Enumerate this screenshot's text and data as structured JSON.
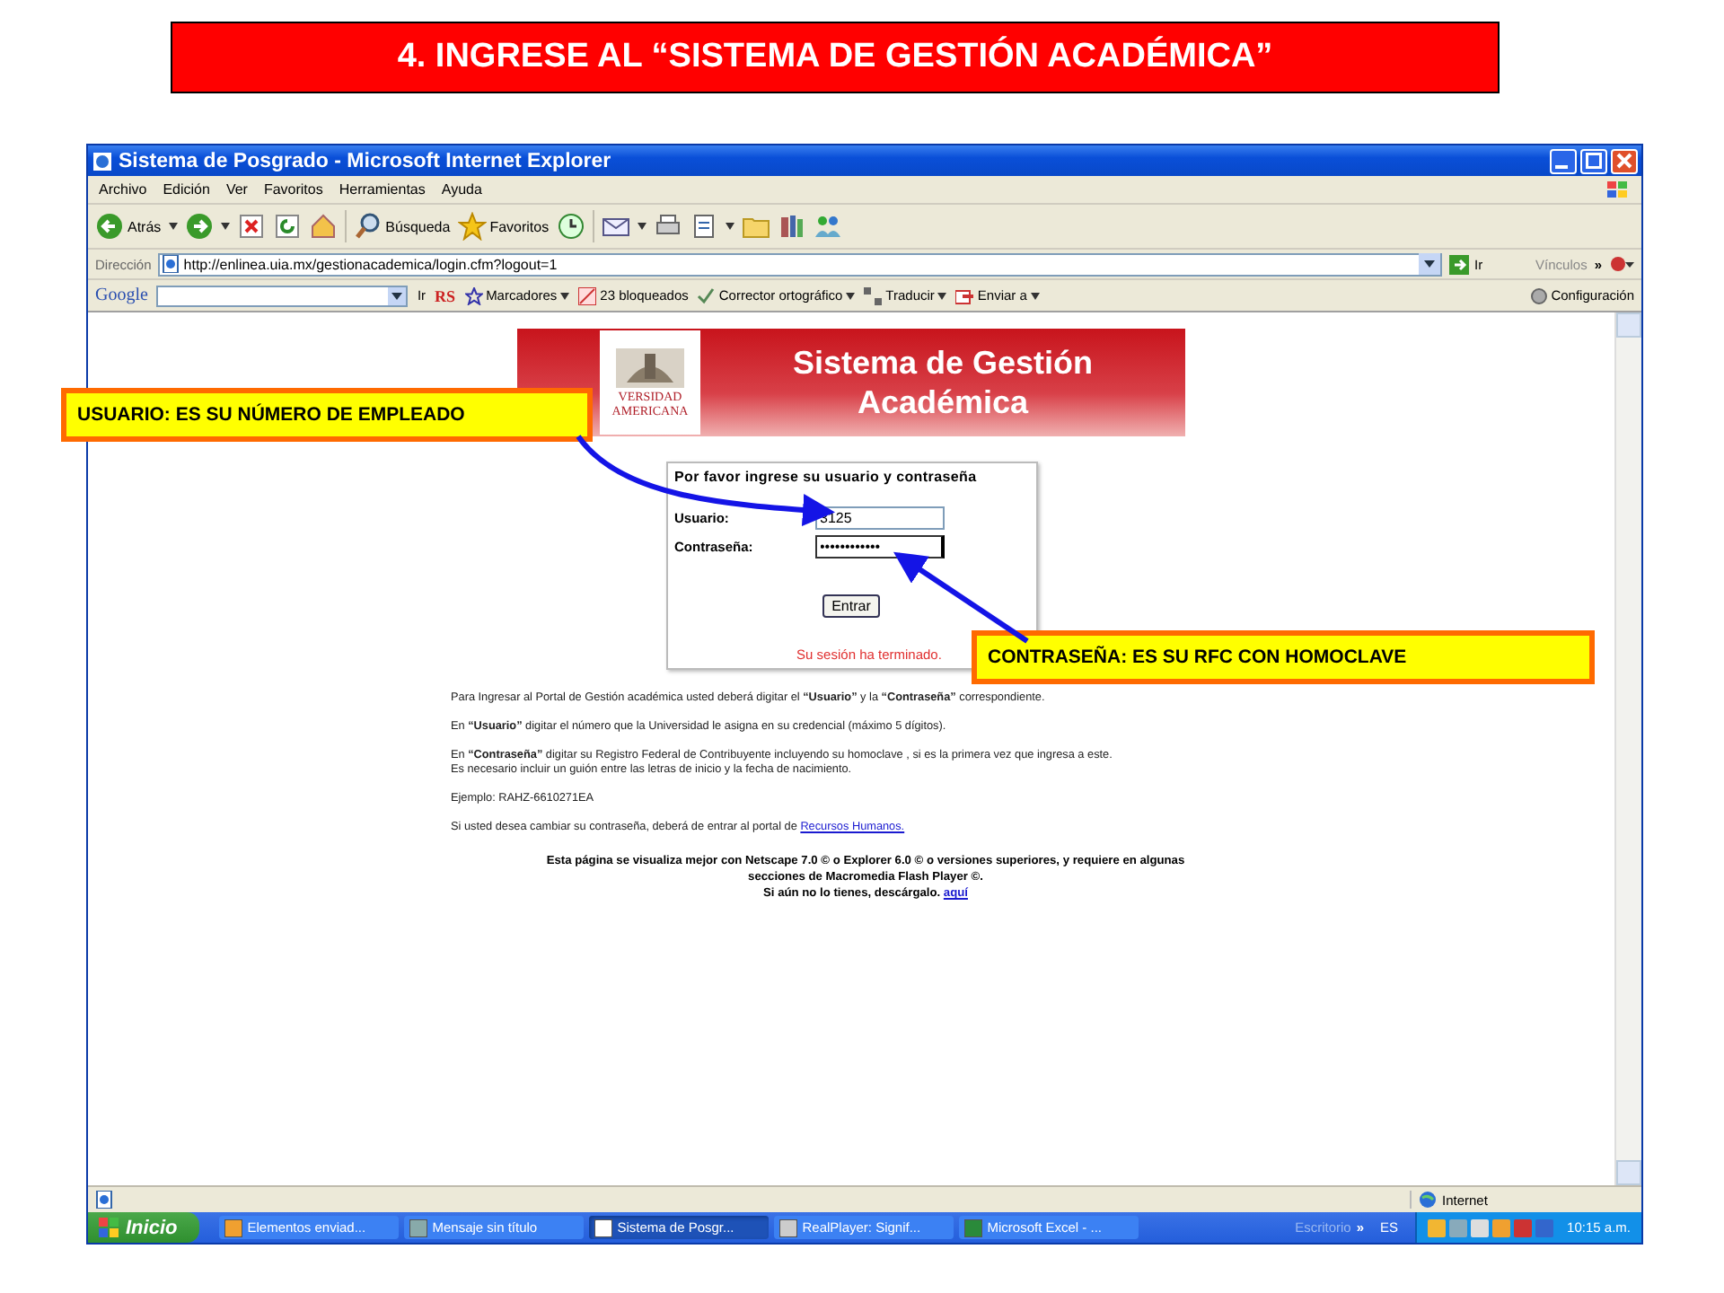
{
  "slide_title": "4. INGRESE AL “SISTEMA DE GESTIÓN ACADÉMICA”",
  "window": {
    "title": "Sistema de Posgrado - Microsoft Internet Explorer",
    "menu": [
      "Archivo",
      "Edición",
      "Ver",
      "Favoritos",
      "Herramientas",
      "Ayuda"
    ],
    "toolbar": [
      {
        "kind": "back",
        "label": "Atrás"
      },
      {
        "kind": "forward"
      },
      {
        "kind": "stop"
      },
      {
        "kind": "refresh"
      },
      {
        "kind": "home"
      },
      {
        "kind": "search",
        "label": "Búsqueda"
      },
      {
        "kind": "favorites",
        "label": "Favoritos"
      },
      {
        "kind": "history"
      },
      {
        "kind": "mail"
      },
      {
        "kind": "print"
      },
      {
        "kind": "edit"
      },
      {
        "kind": "folder"
      },
      {
        "kind": "research"
      },
      {
        "kind": "messenger"
      }
    ],
    "address": {
      "label": "Dirección",
      "value": "http://enlinea.uia.mx/gestionacademica/login.cfm?logout=1",
      "go": "Ir",
      "links": "Vínculos",
      "more": "»"
    },
    "google_bar": {
      "logo": "Google",
      "items": [
        {
          "kind": "plain",
          "label": "Ir"
        },
        {
          "kind": "plain",
          "label": "RS"
        },
        {
          "kind": "menu",
          "label": "Marcadores"
        },
        {
          "kind": "plain",
          "label": "23 bloqueados"
        },
        {
          "kind": "menu",
          "label": "Corrector ortográfico"
        },
        {
          "kind": "menu",
          "label": "Traducir"
        },
        {
          "kind": "menu",
          "label": "Enviar a"
        }
      ],
      "settings": "Configuración"
    },
    "status_bar": {
      "zone": "Internet"
    }
  },
  "page": {
    "banner": {
      "title_lines": [
        "Sistema de Gestión",
        "Académica"
      ],
      "logo_lines": [
        "VERSIDAD",
        "AMERICANA"
      ]
    },
    "login": {
      "heading": "Por favor ingrese su usuario y contraseña",
      "fields": [
        {
          "label": "Usuario:",
          "value": "3125",
          "focused": false
        },
        {
          "label": "Contraseña:",
          "value": "••••••••••••",
          "focused": true
        }
      ],
      "button": "Entrar",
      "message": "Su sesión ha terminado."
    },
    "paragraphs": [
      {
        "lines": [
          "Para Ingresar al Portal de Gestión académica usted deberá digitar el **“Usuario”** y la **“Contraseña”** correspondiente."
        ]
      },
      {
        "lines": [
          "En **“Usuario”** digitar el número que la Universidad le asigna en su credencial (máximo 5 dígitos)."
        ]
      },
      {
        "lines": [
          "En **“Contraseña”** digitar su Registro Federal de Contribuyente incluyendo su homoclave , si es la primera vez que ingresa a este.",
          "Es necesario incluir un guión entre las letras de inicio y la fecha de nacimiento."
        ]
      },
      {
        "lines": [
          "Ejemplo: RAHZ-6610271EA"
        ]
      },
      {
        "lines": [
          "Si usted desea cambiar su contraseña, deberá de entrar al portal de "
        ],
        "link": "Recursos Humanos."
      }
    ],
    "footer": {
      "lines": [
        "Esta página se visualiza mejor con Netscape 7.0 © o Explorer 6.0 © o versiones superiores, y requiere en algunas",
        "secciones de Macromedia Flash Player ©.",
        "Si aún no lo tienes, descárgalo. "
      ],
      "link": "aquí"
    }
  },
  "taskbar": {
    "start": "Inicio",
    "tasks": [
      {
        "label": "Elementos enviad...",
        "selected": false
      },
      {
        "label": "Mensaje sin título",
        "selected": false
      },
      {
        "label": "Sistema de Posgr...",
        "selected": true
      },
      {
        "label": "RealPlayer: Signif...",
        "selected": false
      },
      {
        "label": "Microsoft Excel - ...",
        "selected": false
      }
    ],
    "desktop": "Escritorio",
    "more": "»",
    "language": "ES",
    "clock": "10:15 a.m."
  },
  "callouts": [
    {
      "text": "USUARIO: ES SU NÚMERO DE EMPLEADO"
    },
    {
      "text": "CONTRASEÑA:  ES SU RFC CON HOMOCLAVE"
    }
  ]
}
